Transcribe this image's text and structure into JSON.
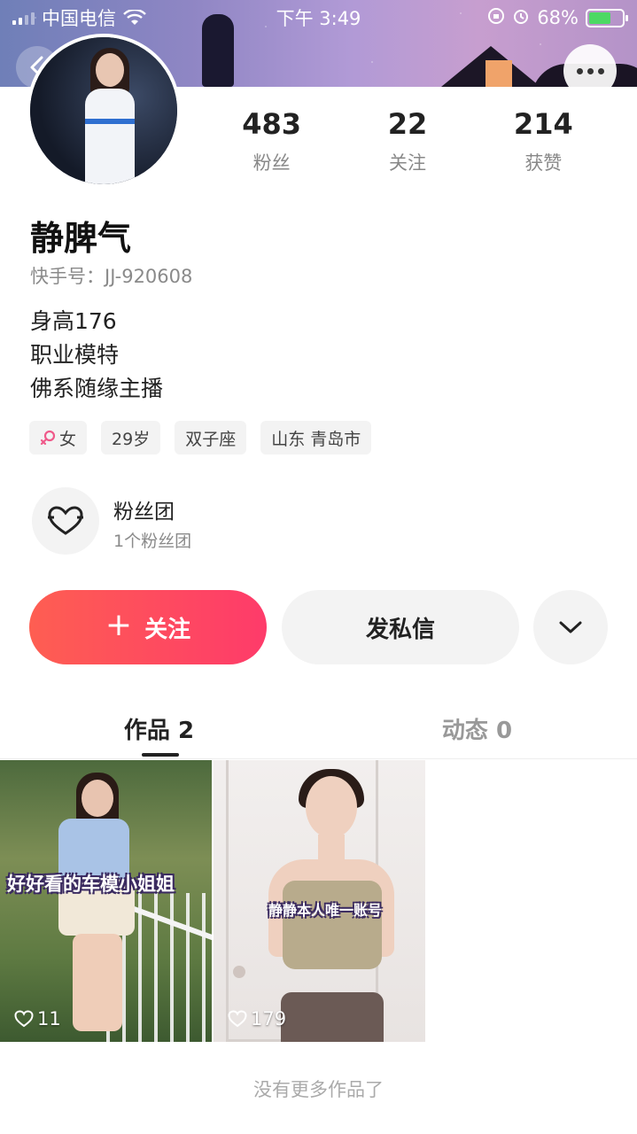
{
  "status_bar": {
    "carrier": "中国电信",
    "time": "下午 3:49",
    "battery": "68%"
  },
  "profile": {
    "stats": [
      {
        "value": "483",
        "label": "粉丝"
      },
      {
        "value": "22",
        "label": "关注"
      },
      {
        "value": "214",
        "label": "获赞"
      }
    ],
    "name": "静脾气",
    "user_id": "快手号：JJ-920608",
    "bio": [
      "身高176",
      "职业模特",
      "佛系随缘主播"
    ],
    "tags": {
      "gender": "女",
      "age": "29岁",
      "zodiac": "双子座",
      "location": "山东 青岛市"
    }
  },
  "fan_group": {
    "title": "粉丝团",
    "subtitle": "1个粉丝团"
  },
  "actions": {
    "follow_label": "关注",
    "message_label": "发私信"
  },
  "tabs": [
    {
      "label": "作品 2",
      "active": true
    },
    {
      "label": "动态 0",
      "active": false
    }
  ],
  "works": [
    {
      "caption": "好好看的车模小姐姐",
      "likes": "11"
    },
    {
      "caption": "静静本人唯一账号",
      "likes": "179"
    }
  ],
  "footer": {
    "no_more": "没有更多作品了"
  },
  "colors": {
    "follow_gradient_start": "#fe5e52",
    "follow_gradient_end": "#fe3b6a",
    "female_icon": "#ef5a8a",
    "battery_fill": "#4cd964"
  }
}
